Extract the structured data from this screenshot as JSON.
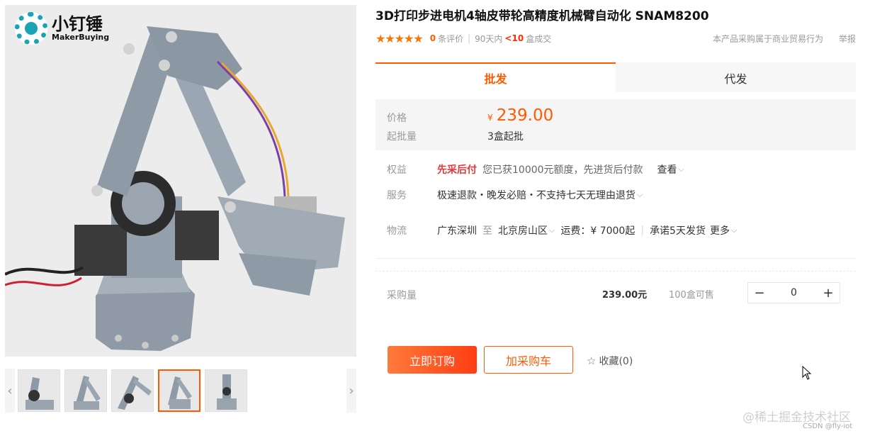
{
  "brand": {
    "name_cn": "小钉锤",
    "name_en": "MakerBuying"
  },
  "product": {
    "title": "3D打印步进电机4轴皮带轮高精度机械臂自动化 SNAM8200",
    "stars": "★★★★★",
    "review_count": "0",
    "review_suffix": "条评价",
    "sales_prefix": "90天内",
    "sales_count": "<10",
    "sales_suffix": "盒成交",
    "trade_notice": "本产品采购属于商业贸易行为",
    "report": "举报"
  },
  "tabs": [
    {
      "label": "批发",
      "active": true
    },
    {
      "label": "代发",
      "active": false
    }
  ],
  "pricing": {
    "price_label": "价格",
    "currency": "¥",
    "price": "239.00",
    "moq_label": "起批量",
    "moq": "3盒起批"
  },
  "benefits": {
    "label": "权益",
    "highlight": "先采后付",
    "text": "您已获10000元额度，先进货后付款",
    "link": "查看"
  },
  "service": {
    "label": "服务",
    "text": "极速退款・晚发必赔・不支持七天无理由退货"
  },
  "logistics": {
    "label": "物流",
    "from": "广东深圳",
    "to_word": "至",
    "to": "北京房山区",
    "fee": "运费：¥ 7000起",
    "promise": "承诺5天发货",
    "more": "更多"
  },
  "purchase": {
    "label": "采购量",
    "unit_price": "239.00元",
    "stock": "100盒可售",
    "minus": "−",
    "quantity": "0",
    "plus": "+"
  },
  "actions": {
    "buy_now": "立即订购",
    "add_cart": "加采购车",
    "favorite": "收藏(0)"
  },
  "footer": {
    "watermark": "@稀土掘金技术社区",
    "watermark_small": "CSDN @fly-iot"
  },
  "colors": {
    "accent": "#ff5a00",
    "brand_teal": "#1aa3b4"
  }
}
